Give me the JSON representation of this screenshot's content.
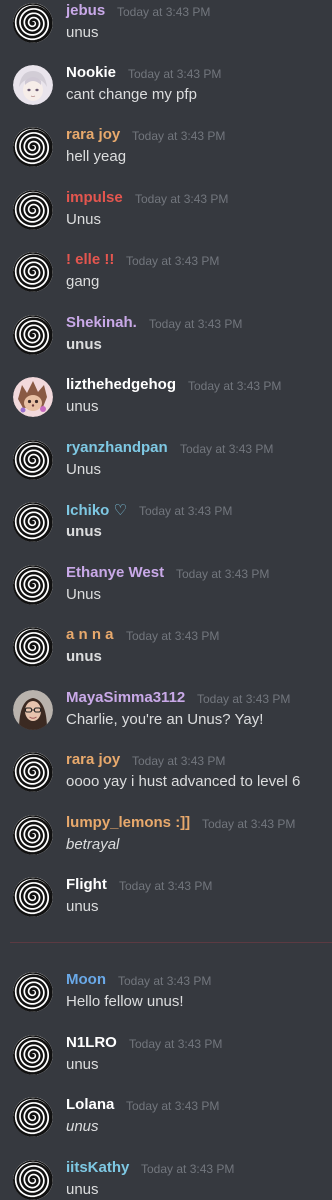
{
  "timestamp_label": "Today at 3:43 PM",
  "colors": {
    "background": "#36393f",
    "message_text": "#dcddde",
    "timestamp": "#72767d",
    "divider": "#5c3a42"
  },
  "messages": [
    {
      "author": "jebus",
      "author_color": "#c9a9e8",
      "text": "unus",
      "style": "normal",
      "avatar": "spiral-icon"
    },
    {
      "author": "Nookie",
      "author_color": "#ffffff",
      "text": "cant change my pfp",
      "style": "normal",
      "avatar": "anime-avatar"
    },
    {
      "author": "rara joy",
      "author_color": "#e8a96c",
      "text": "hell yeag",
      "style": "normal",
      "avatar": "spiral-icon"
    },
    {
      "author": "impulse",
      "author_color": "#e4564f",
      "text": "Unus",
      "style": "normal",
      "avatar": "spiral-icon"
    },
    {
      "author": "! elle !!",
      "author_color": "#e4564f",
      "text": "gang",
      "style": "normal",
      "avatar": "spiral-icon"
    },
    {
      "author": "Shekinah.",
      "author_color": "#c9a9e8",
      "text": "unus",
      "style": "bold",
      "avatar": "spiral-icon"
    },
    {
      "author": "lizthehedgehog",
      "author_color": "#ffffff",
      "text": "unus",
      "style": "normal",
      "avatar": "hedgehog-avatar"
    },
    {
      "author": "ryanzhandpan",
      "author_color": "#7ec8e3",
      "text": "Unus",
      "style": "normal",
      "avatar": "spiral-icon"
    },
    {
      "author": "Ichiko ♡",
      "author_color": "#7ec8e3",
      "text": "unus",
      "style": "bold",
      "avatar": "spiral-icon"
    },
    {
      "author": "Ethanye West",
      "author_color": "#c9a9e8",
      "text": "Unus",
      "style": "normal",
      "avatar": "spiral-icon"
    },
    {
      "author": "a n n a",
      "author_color": "#e8a96c",
      "text": "unus",
      "style": "bold",
      "avatar": "spiral-icon"
    },
    {
      "author": "MayaSimma3112",
      "author_color": "#c9a9e8",
      "text": "Charlie, you're an Unus? Yay!",
      "style": "normal",
      "avatar": "photo-avatar"
    },
    {
      "author": "rara joy",
      "author_color": "#e8a96c",
      "text": "oooo yay i hust advanced to level 6",
      "style": "normal",
      "avatar": "spiral-icon"
    },
    {
      "author": "lumpy_lemons :]]",
      "author_color": "#e8a96c",
      "text": "betrayal",
      "style": "italic",
      "avatar": "spiral-icon"
    },
    {
      "author": "Flight",
      "author_color": "#ffffff",
      "text": "unus",
      "style": "normal",
      "avatar": "spiral-icon"
    },
    {
      "author": "Moon",
      "author_color": "#6aa9e8",
      "text": "Hello fellow unus!",
      "style": "normal",
      "avatar": "spiral-icon"
    },
    {
      "author": "N1LRO",
      "author_color": "#ffffff",
      "text": "unus",
      "style": "normal",
      "avatar": "spiral-icon"
    },
    {
      "author": "Lolana",
      "author_color": "#ffffff",
      "text": "unus",
      "style": "italic",
      "avatar": "spiral-icon"
    },
    {
      "author": "iitsKathy",
      "author_color": "#7ec8e3",
      "text": "unus",
      "style": "normal",
      "avatar": "spiral-icon"
    }
  ]
}
